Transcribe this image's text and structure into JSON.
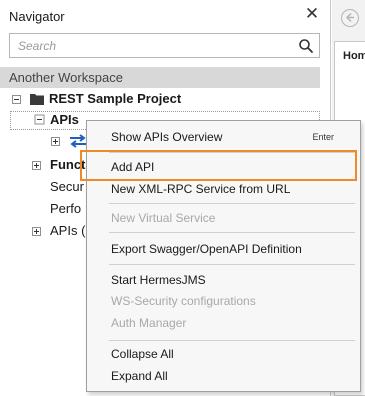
{
  "navigator": {
    "title": "Navigator",
    "close_glyph": "✕",
    "search": {
      "placeholder": "Search",
      "value": ""
    },
    "workspace": "Another Workspace",
    "tree": {
      "project": "REST Sample Project",
      "apis": "APIs",
      "functional": "Funct",
      "security": "Secur",
      "performance": "Perfo",
      "apis_other": "APIs ("
    }
  },
  "right_panel": {
    "header": "Hom"
  },
  "context_menu": {
    "items": [
      {
        "label": "Show APIs Overview",
        "shortcut": "Enter"
      },
      {
        "label": "Add API"
      },
      {
        "label": "New XML-RPC Service from URL"
      },
      {
        "label": "New Virtual Service"
      },
      {
        "label": "Export Swagger/OpenAPI Definition"
      },
      {
        "label": "Start HermesJMS"
      },
      {
        "label": "WS-Security configurations"
      },
      {
        "label": "Auth Manager"
      },
      {
        "label": "Collapse All"
      },
      {
        "label": "Expand All"
      }
    ]
  },
  "colors": {
    "highlight": "#f08a24",
    "folder": "#3a3a3a",
    "selection": "#d8d8d8",
    "link_icon": "#1f5fbf"
  }
}
